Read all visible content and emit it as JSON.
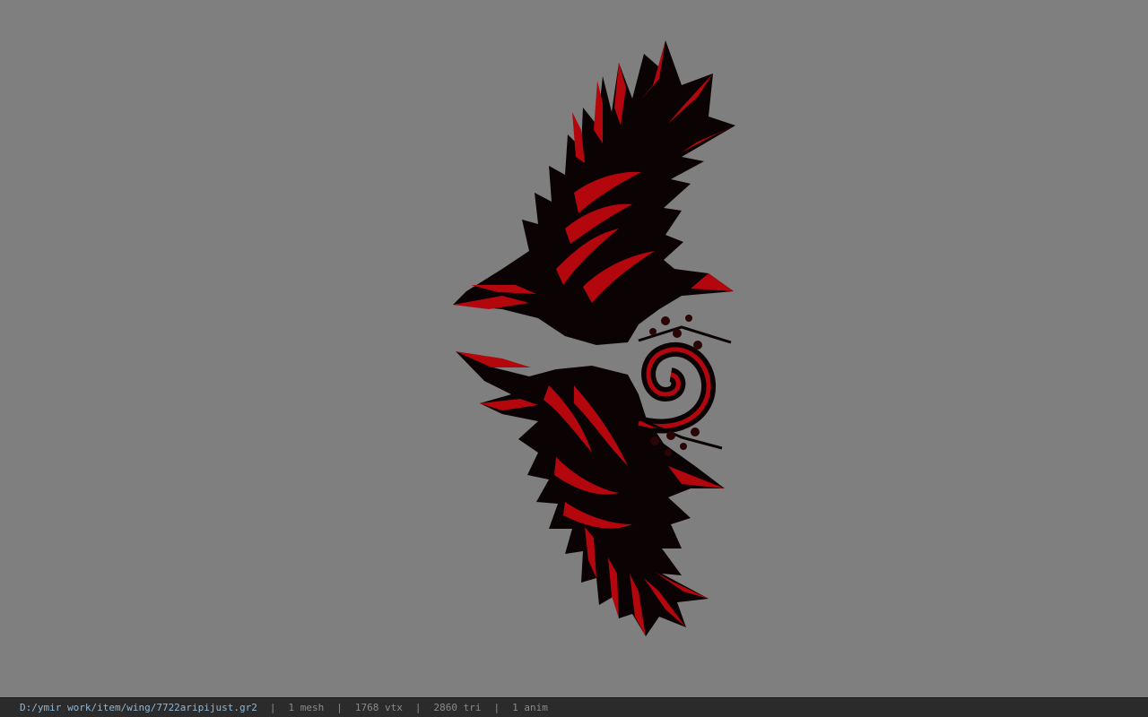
{
  "viewer": {
    "background": "#7f7f7f",
    "model_colors": {
      "dark": "#0b0303",
      "accent": "#b3070d",
      "mid": "#5a0a0c"
    }
  },
  "status": {
    "path": "D:/ymir work/item/wing/7722aripijust.gr2",
    "separator": "|",
    "mesh": "1 mesh",
    "vtx": "1768 vtx",
    "tri": "2860 tri",
    "anim": "1 anim"
  }
}
